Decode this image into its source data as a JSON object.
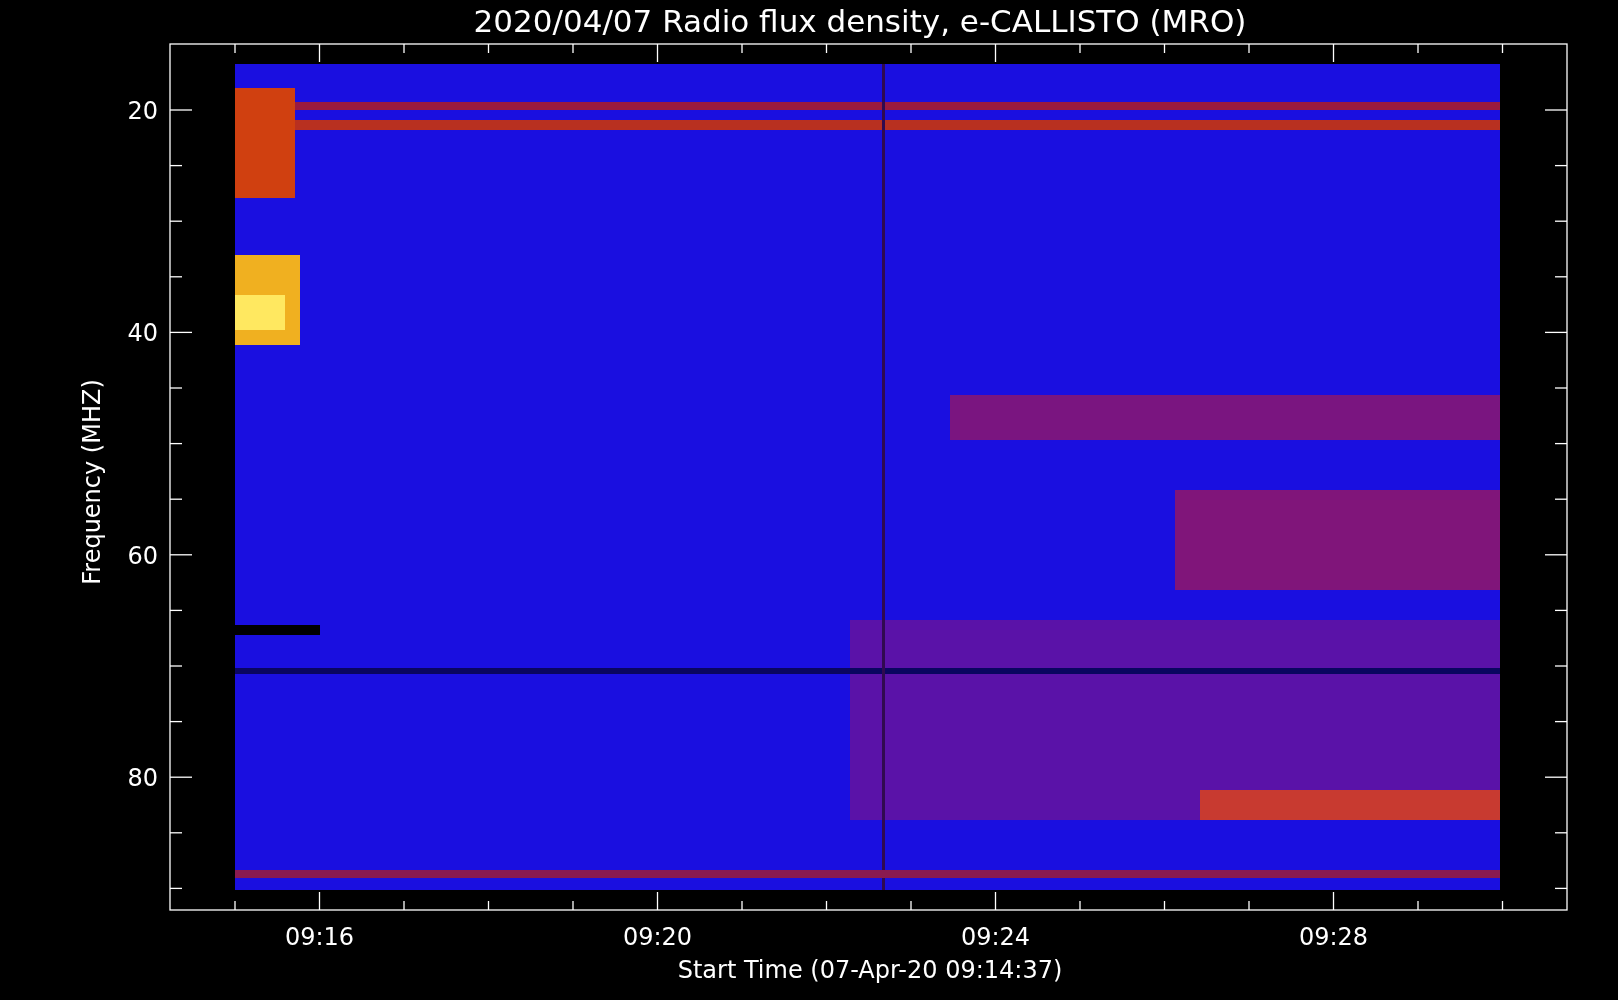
{
  "plot": {
    "title": "2020/04/07  Radio flux density, e-CALLISTO (MRO)",
    "ylabel": "Frequency (MHZ)",
    "xlabel": "Start Time (07-Apr-20 09:14:37)",
    "yticks": [
      "20",
      "40",
      "60",
      "80"
    ],
    "xticks": [
      "09:16",
      "09:20",
      "09:24",
      "09:28"
    ]
  }
}
